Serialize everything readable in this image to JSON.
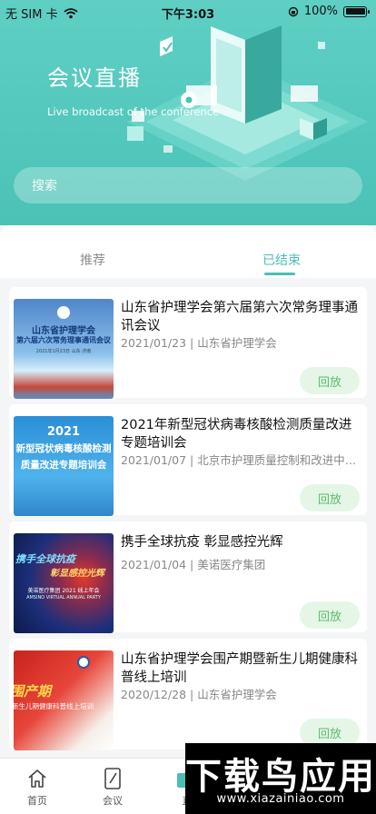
{
  "status_bar": {
    "carrier": "无 SIM 卡",
    "time": "下午3:03",
    "battery": "100%",
    "battery_level": 1.0
  },
  "hero": {
    "title": "会议直播",
    "subtitle": "Live broadcast of the conference"
  },
  "search": {
    "placeholder": "搜索"
  },
  "tabs": [
    {
      "label": "推荐",
      "active": false
    },
    {
      "label": "已结束",
      "active": true
    }
  ],
  "conferences": [
    {
      "title": "山东省护理学会第六届第六次常务理事通讯会议",
      "meta": "2021/01/23 | 山东省护理学会",
      "action": "回放",
      "thumb_line1": "山东省护理学会",
      "thumb_line2": "第六届六次常务理事通讯会议",
      "thumb_date": "2021年1月23日 山东·济南"
    },
    {
      "title": "2021年新型冠状病毒核酸检测质量改进专题培训会",
      "meta": "2021/01/07 | 北京市护理质量控制和改进中心、北...",
      "action": "回放",
      "thumb_line1": "2021",
      "thumb_line2": "新型冠状病毒核酸检测",
      "thumb_line3": "质量改进专题培训会"
    },
    {
      "title": "携手全球抗疫  彰显感控光辉",
      "meta": "2021/01/04 | 美诺医疗集团",
      "action": "回放",
      "thumb_line1": "携手全球抗疫",
      "thumb_line2": "彰显感控光辉",
      "thumb_line3": "美诺医疗集团 2021 线上年会",
      "thumb_line4": "AMSINO VIRTUAL ANNUAL PARTY"
    },
    {
      "title": "山东省护理学会围产期暨新生儿期健康科普线上培训",
      "meta": "2020/12/28 | 山东省护理学会",
      "action": "回放",
      "thumb_line1": "围产期",
      "thumb_line2": "新生儿期健康科普线上培训"
    }
  ],
  "bottom_nav": [
    {
      "label": "首页",
      "icon": "home-icon"
    },
    {
      "label": "会议",
      "icon": "edit-icon"
    },
    {
      "label": "直",
      "icon": "live-icon"
    }
  ],
  "watermark": {
    "text": "下载鸟应用",
    "url": "www.xiazainiao.com"
  },
  "colors": {
    "primary": "#4bbfb3",
    "replay_bg": "#e5f6e7",
    "replay_text": "#5dba6a"
  }
}
